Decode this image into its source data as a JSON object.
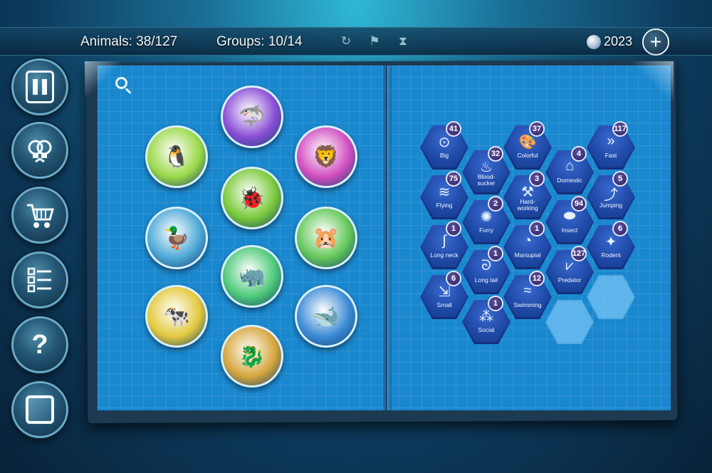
{
  "header": {
    "animals_label": "Animals: 38/127",
    "groups_label": "Groups: 10/14",
    "coins": "2023"
  },
  "toolbar_icons": [
    "refresh-icon",
    "checkered-flag-icon",
    "hourglass-icon"
  ],
  "sidebar_icons": [
    "pause-icon",
    "hint-lightbulb-icon",
    "shop-cart-icon",
    "checklist-icon",
    "help-question-icon",
    "window-icon"
  ],
  "help_glyph": "?",
  "add_glyph": "+",
  "group_medallions": [
    {
      "name": "birds",
      "glyph": "🐧",
      "color": "#9bd94a"
    },
    {
      "name": "fish-shark",
      "glyph": "🦈",
      "color": "#8a4fd6"
    },
    {
      "name": "big-cats",
      "glyph": "🦁",
      "color": "#d14fc0"
    },
    {
      "name": "insects",
      "glyph": "🐞",
      "color": "#7ac93a"
    },
    {
      "name": "waterfowl",
      "glyph": "🦆",
      "color": "#4fa9d8"
    },
    {
      "name": "rodents",
      "glyph": "🐹",
      "color": "#64c85a"
    },
    {
      "name": "rhino-hippo",
      "glyph": "🦏",
      "color": "#4ec97a"
    },
    {
      "name": "farm-animals",
      "glyph": "🐄",
      "color": "#e3c93e"
    },
    {
      "name": "whale-dolphin",
      "glyph": "🐋",
      "color": "#3d8bd6"
    },
    {
      "name": "dragon-chimera",
      "glyph": "🐉",
      "color": "#d6a63e"
    }
  ],
  "groups": [
    {
      "label": "Big",
      "count": "41",
      "icon": "⊙"
    },
    {
      "label": "Colorful",
      "count": "37",
      "icon": "🎨"
    },
    {
      "label": "Fast",
      "count": "117",
      "icon": "»"
    },
    {
      "label": "Blood-\nsucker",
      "count": "32",
      "icon": "♨"
    },
    {
      "label": "Domestic",
      "count": "4",
      "icon": "⌂"
    },
    {
      "label": "Flying",
      "count": "75",
      "icon": "≋"
    },
    {
      "label": "Hard-\nworking",
      "count": "3",
      "icon": "⚒"
    },
    {
      "label": "Jumping",
      "count": "5",
      "icon": "⤴"
    },
    {
      "label": "Furry",
      "count": "2",
      "icon": "✺"
    },
    {
      "label": "Insect",
      "count": "94",
      "icon": "⬬"
    },
    {
      "label": "Long neck",
      "count": "1",
      "icon": "∫"
    },
    {
      "label": "Marsupial",
      "count": "1",
      "icon": "◔"
    },
    {
      "label": "Rodent",
      "count": "6",
      "icon": "✦"
    },
    {
      "label": "Long tail",
      "count": "1",
      "icon": "ᘐ"
    },
    {
      "label": "Predator",
      "count": "127",
      "icon": "⩗"
    },
    {
      "label": "Small",
      "count": "6",
      "icon": "⇲"
    },
    {
      "label": "Swimming",
      "count": "12",
      "icon": "≈"
    },
    {
      "label": "Social",
      "count": "1",
      "icon": "⁂"
    }
  ]
}
